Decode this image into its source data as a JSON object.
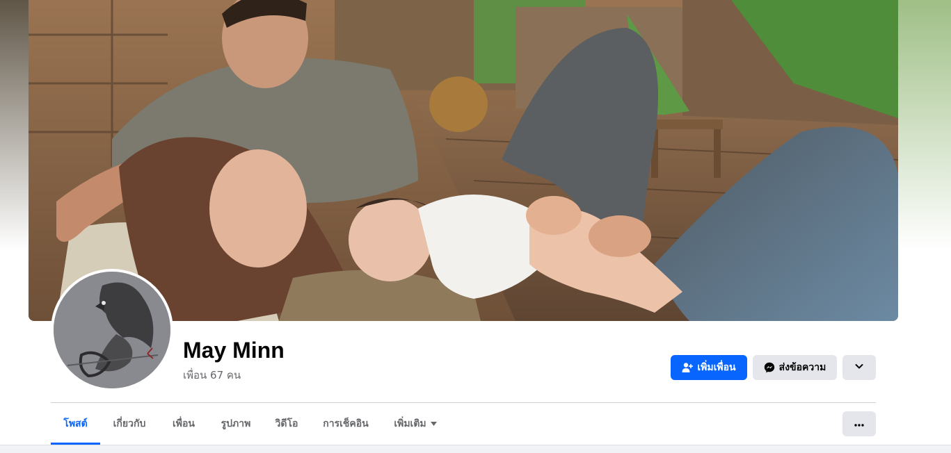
{
  "profile": {
    "name": "May Minn",
    "friends_count": "เพื่อน 67 คน"
  },
  "actions": {
    "add_friend_label": "เพิ่มเพื่อน",
    "message_label": "ส่งข้อความ"
  },
  "tabs": [
    {
      "label": "โพสต์",
      "active": true
    },
    {
      "label": "เกี่ยวกับ",
      "active": false
    },
    {
      "label": "เพื่อน",
      "active": false
    },
    {
      "label": "รูปภาพ",
      "active": false
    },
    {
      "label": "วิดีโอ",
      "active": false
    },
    {
      "label": "การเช็คอิน",
      "active": false
    },
    {
      "label": "เพิ่มเติม",
      "active": false
    }
  ],
  "icons": {
    "add_friend": "add-friend-icon",
    "messenger": "messenger-icon",
    "chevron": "chevron-down-icon",
    "more": "more-dots-icon",
    "caret": "caret-down-icon"
  },
  "colors": {
    "accent": "#0866ff",
    "secondary_button": "#e4e6eb",
    "muted_text": "#65676b"
  }
}
